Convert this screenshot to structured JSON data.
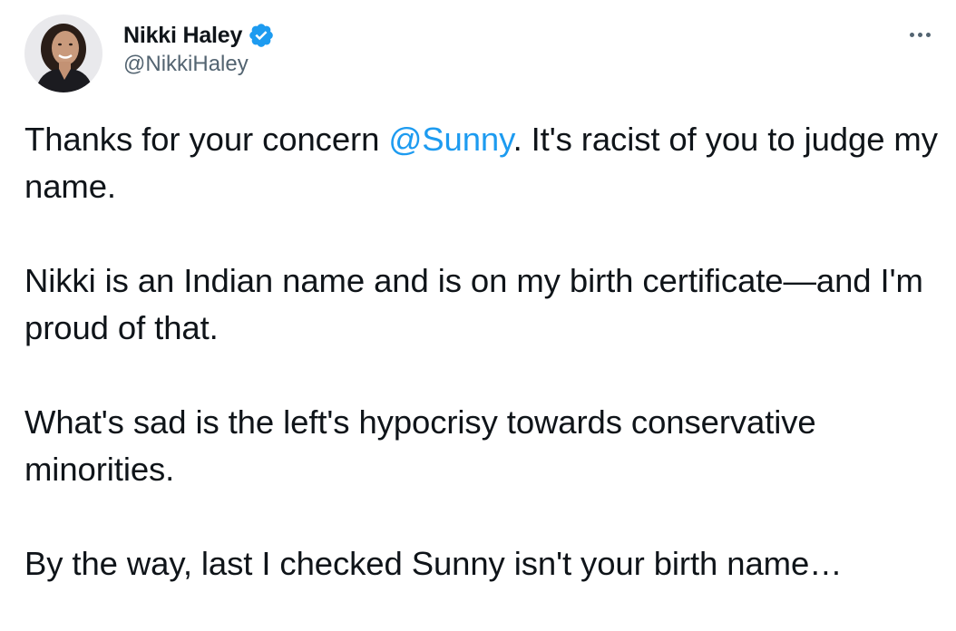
{
  "author": {
    "display_name": "Nikki Haley",
    "handle": "@NikkiHaley",
    "verified": true
  },
  "menu": {
    "icon": "more-horizontal-icon"
  },
  "tweet": {
    "p1_before": "Thanks for your concern ",
    "p1_mention": "@Sunny",
    "p1_after": ". It's racist of you to judge my name.",
    "p2": "Nikki is an Indian name and is on my birth certificate—and I'm proud of that.",
    "p3": "What's sad is the left's hypocrisy towards conservative minorities.",
    "p4": "By the way, last I checked Sunny isn't your birth name…"
  },
  "colors": {
    "text": "#0f1419",
    "secondary": "#536471",
    "accent": "#1d9bf0"
  }
}
